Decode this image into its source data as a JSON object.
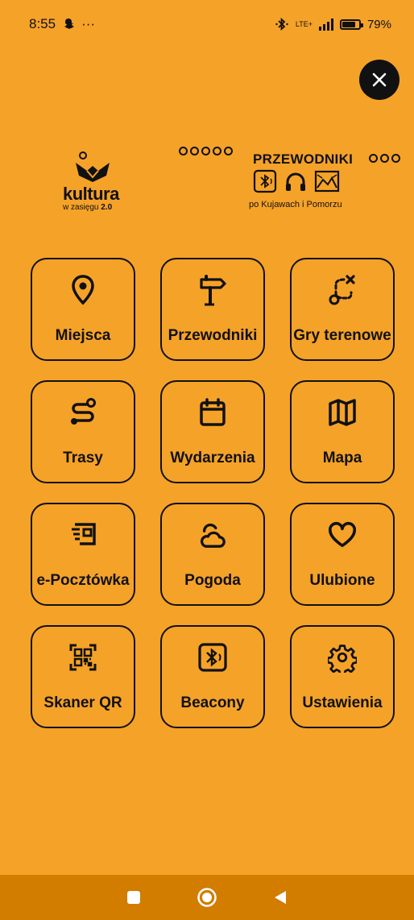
{
  "status_bar": {
    "time": "8:55",
    "more": "···",
    "network": "LTE+",
    "battery_text": "79%",
    "battery_level": 0.79
  },
  "header": {
    "left_logo": {
      "word": "kultura",
      "sub_prefix": "w zasięgu",
      "sub_version": "2.0"
    },
    "right_logo": {
      "title": "PRZEWODNIKI",
      "subtitle": "po Kujawach i Pomorzu"
    }
  },
  "menu": {
    "tiles": [
      {
        "label": "Miejsca",
        "icon": "location-pin-icon"
      },
      {
        "label": "Przewodniki",
        "icon": "signpost-icon"
      },
      {
        "label": "Gry terenowe",
        "icon": "treasure-route-icon"
      },
      {
        "label": "Trasy",
        "icon": "route-icon"
      },
      {
        "label": "Wydarzenia",
        "icon": "calendar-icon"
      },
      {
        "label": "Mapa",
        "icon": "map-icon"
      },
      {
        "label": "e-Pocztówka",
        "icon": "postcard-icon"
      },
      {
        "label": "Pogoda",
        "icon": "weather-icon"
      },
      {
        "label": "Ulubione",
        "icon": "heart-icon"
      },
      {
        "label": "Skaner QR",
        "icon": "qr-scan-icon"
      },
      {
        "label": "Beacony",
        "icon": "bluetooth-beacon-icon"
      },
      {
        "label": "Ustawienia",
        "icon": "gear-icon"
      }
    ]
  },
  "colors": {
    "background": "#F5A229",
    "nav_bar": "#D27C00",
    "ink": "#111111"
  }
}
